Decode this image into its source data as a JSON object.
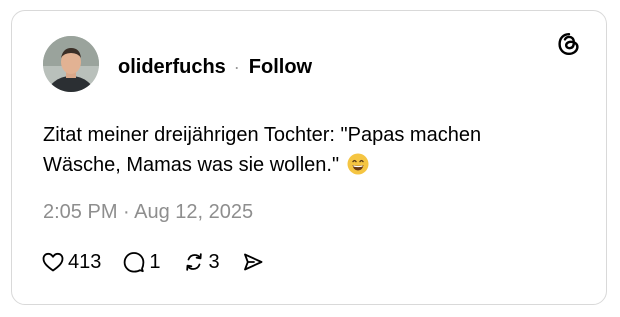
{
  "post": {
    "username": "oliderfuchs",
    "separator": "·",
    "follow_label": "Follow",
    "text": "Zitat meiner dreijährigen Tochter: \"Papas machen Wäsche, Mamas was sie wollen.\"",
    "emoji": "smiling-face-with-open-mouth-and-smiling-eyes",
    "timestamp": "2:05 PM · Aug 12, 2025"
  },
  "actions": {
    "likes": "413",
    "replies": "1",
    "reposts": "3"
  },
  "icons": {
    "brand": "threads-logo-icon",
    "like": "heart-icon",
    "reply": "speech-bubble-icon",
    "repost": "repost-icon",
    "share": "send-icon"
  },
  "colors": {
    "text": "#000000",
    "muted": "#8e8e8e",
    "border": "#d9d9d9",
    "emoji_face": "#f5c542"
  }
}
